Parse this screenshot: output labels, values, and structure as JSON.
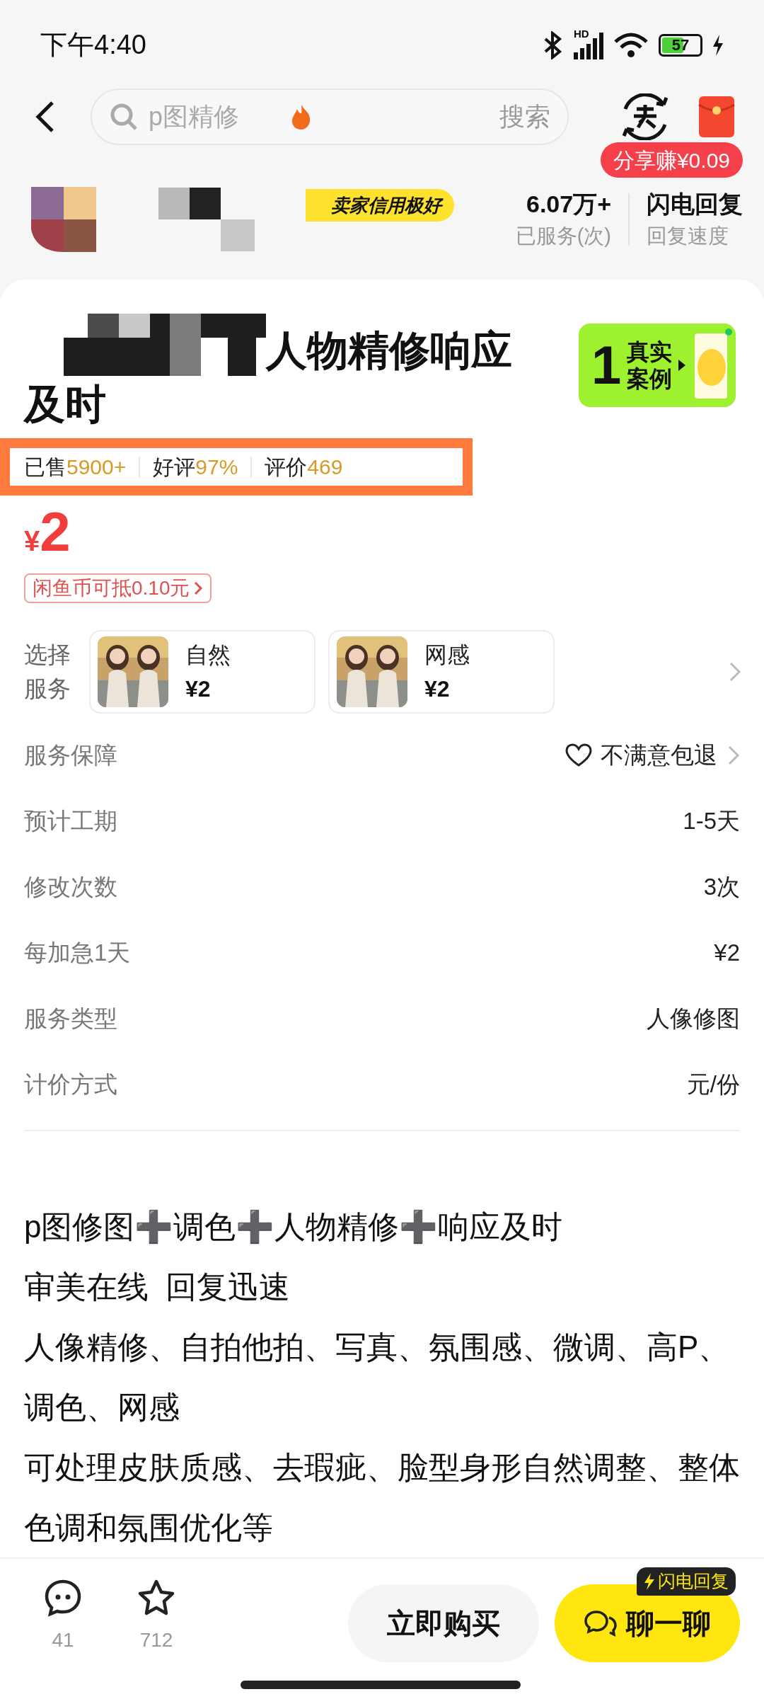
{
  "status_bar": {
    "time": "下午4:40",
    "network": "HD",
    "battery": "57"
  },
  "search": {
    "placeholder": "p图精修",
    "button": "搜索"
  },
  "share_badge": "分享赚¥0.09",
  "seller": {
    "badge": "卖家信用极好",
    "stats": [
      {
        "value": "6.07万+",
        "label": "已服务(次)"
      },
      {
        "value": "闪电回复",
        "label": "回复速度"
      }
    ]
  },
  "title_lines": [
    "人物精修响应",
    "及时"
  ],
  "cases_badge": {
    "count": "1",
    "label": "真实案例"
  },
  "sales": [
    {
      "label": "已售",
      "value": "5900+"
    },
    {
      "label": "好评",
      "value": "97%"
    },
    {
      "label": "评价",
      "value": "469"
    }
  ],
  "price": {
    "currency": "¥",
    "amount": "2"
  },
  "coin_tag": "闲鱼币可抵0.10元",
  "services": {
    "label": "选择服务",
    "options": [
      {
        "kind": "picture",
        "name": "自然",
        "price": "¥2"
      },
      {
        "kind": "picture",
        "name": "网感",
        "price": "¥2"
      }
    ]
  },
  "details": [
    {
      "label": "服务保障",
      "value": "不满意包退",
      "kind": "guarantee"
    },
    {
      "label": "预计工期",
      "value": "1-5天",
      "kind": "plain"
    },
    {
      "label": "修改次数",
      "value": "3次",
      "kind": "plain"
    },
    {
      "label": "每加急1天",
      "value": "¥2",
      "kind": "plain"
    },
    {
      "label": "服务类型",
      "value": "人像修图",
      "kind": "plain"
    },
    {
      "label": "计价方式",
      "value": "元/份",
      "kind": "plain"
    }
  ],
  "description": [
    "p图修图➕调色➕人物精修➕响应及时",
    "审美在线  回复迅速",
    "人像精修、自拍他拍、写真、氛围感、微调、高P、调色、网感",
    "可处理皮肤质感、去瑕疵、脸型身形自然调整、整体色调和氛围优化等"
  ],
  "bottom_bar": {
    "actions": [
      {
        "kind": "comment",
        "count": "41"
      },
      {
        "kind": "favorite",
        "count": "712"
      }
    ],
    "buy": "立即购买",
    "chat": "聊一聊",
    "chat_badge": "闪电回复"
  }
}
